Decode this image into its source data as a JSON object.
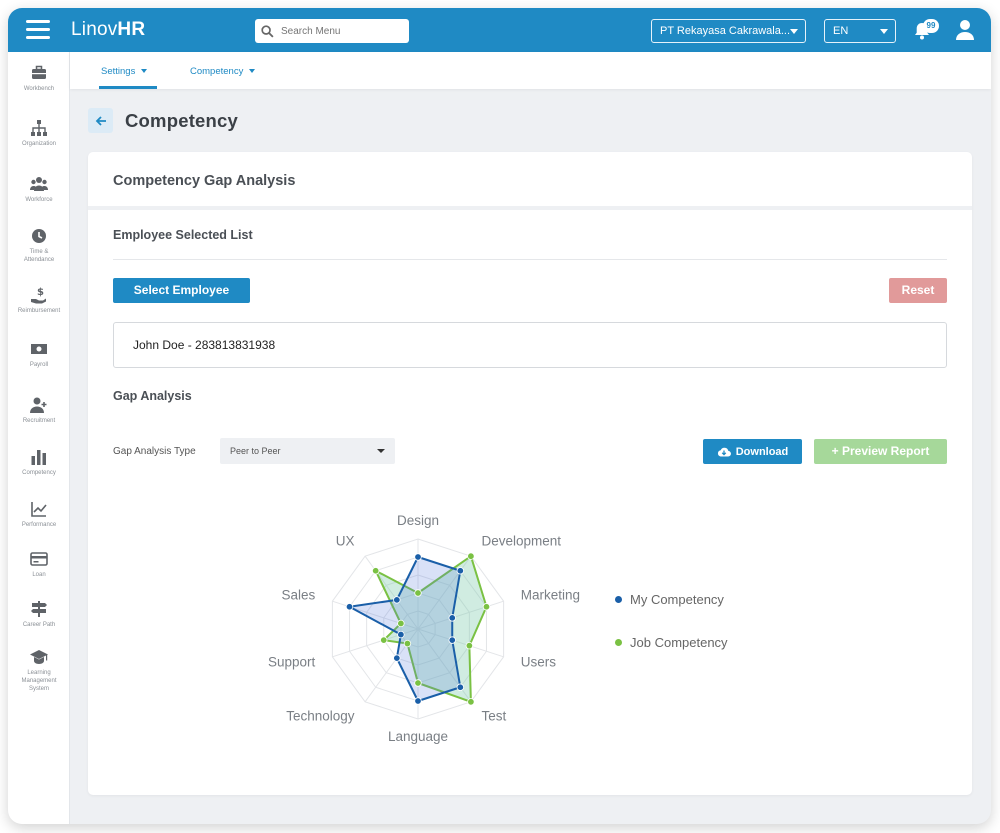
{
  "app": {
    "logo_light": "Linov",
    "logo_bold": "HR",
    "badge_count": "99"
  },
  "search": {
    "placeholder": "Search Menu"
  },
  "company": {
    "selected": "PT Rekayasa Cakrawala..."
  },
  "language": {
    "selected": "EN"
  },
  "sidebar": {
    "items": [
      {
        "label": "Workbench",
        "icon": "briefcase-icon"
      },
      {
        "label": "Organization",
        "icon": "org-chart-icon"
      },
      {
        "label": "Workforce",
        "icon": "people-icon"
      },
      {
        "label": "Time & Attendance",
        "icon": "clock-icon"
      },
      {
        "label": "Reimbursement",
        "icon": "money-hand-icon"
      },
      {
        "label": "Payroll",
        "icon": "banknote-icon"
      },
      {
        "label": "Recruitment",
        "icon": "add-user-icon"
      },
      {
        "label": "Competency",
        "icon": "bar-chart-icon"
      },
      {
        "label": "Performance",
        "icon": "line-chart-icon"
      },
      {
        "label": "Loan",
        "icon": "card-icon"
      },
      {
        "label": "Career Path",
        "icon": "signpost-icon"
      },
      {
        "label": "Learning Management System",
        "icon": "graduation-cap-icon"
      }
    ]
  },
  "subnav": {
    "tabs": [
      {
        "label": "Settings"
      },
      {
        "label": "Competency"
      }
    ]
  },
  "page": {
    "title": "Competency"
  },
  "card": {
    "title": "Competency Gap Analysis",
    "employee_section": "Employee Selected List",
    "select_button": "Select Employee",
    "reset_button": "Reset",
    "employees": [
      "John Doe - 283813831938"
    ],
    "gap_section": "Gap Analysis",
    "type_label": "Gap Analysis Type",
    "type_value": "Peer to Peer",
    "download_button": "Download",
    "preview_button": "+ Preview Report"
  },
  "colors": {
    "primary": "#1f8ac4",
    "reset": "#e19a9a",
    "preview": "#a6d89a",
    "my_competency": "#1a5fa8",
    "job_competency": "#7ac143"
  },
  "chart_data": {
    "type": "radar",
    "categories": [
      "Design",
      "Development",
      "Marketing",
      "Users",
      "Test",
      "Language",
      "Technology",
      "Support",
      "Sales",
      "UX"
    ],
    "series": [
      {
        "name": "My Competency",
        "values": [
          4,
          4,
          2,
          2,
          4,
          4,
          2,
          1,
          4,
          2
        ]
      },
      {
        "name": "Job Competency",
        "values": [
          2,
          5,
          4,
          3,
          5,
          3,
          1,
          2,
          1,
          4
        ]
      }
    ],
    "scale": [
      0,
      5
    ],
    "legend": "right"
  }
}
